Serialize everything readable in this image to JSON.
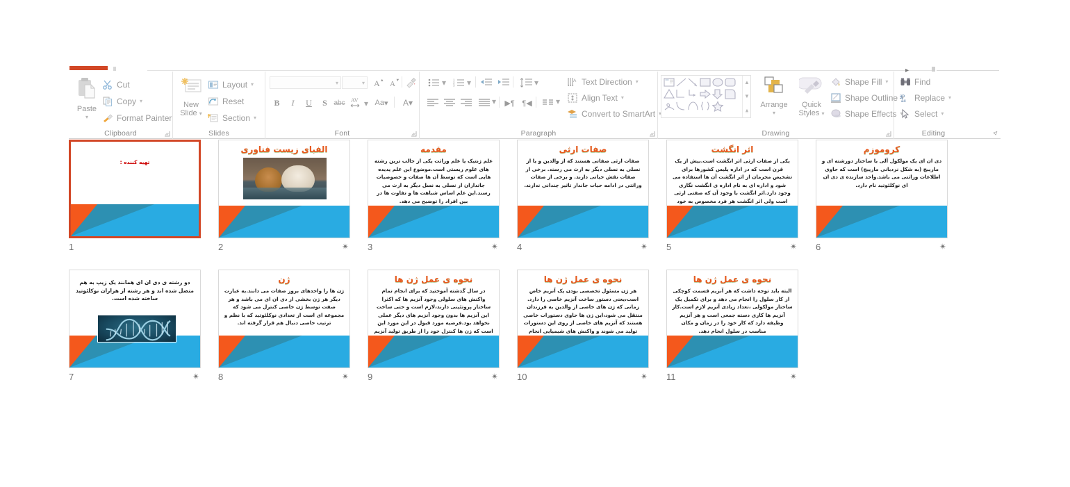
{
  "app": {
    "name": "PowerPoint Slide Sorter",
    "accent_orange": "#d24726",
    "slide_accent_blue": "#29abe2",
    "slide_accent_orange": "#f4581c",
    "title_color": "#e8591e"
  },
  "ribbon": {
    "groups": [
      {
        "name": "clipboard",
        "label": "Clipboard",
        "big_button": {
          "label_line1": "Paste",
          "caret": "▾",
          "icon": "paste-icon"
        },
        "items": [
          {
            "label": "Cut",
            "icon": "scissors-icon",
            "caret": ""
          },
          {
            "label": "Copy",
            "icon": "copy-icon",
            "caret": "▾"
          },
          {
            "label": "Format Painter",
            "icon": "format-painter-icon",
            "caret": ""
          }
        ],
        "has_launcher": true
      },
      {
        "name": "slides",
        "label": "Slides",
        "big_button": {
          "label_line1": "New",
          "label_line2": "Slide",
          "caret": "▾",
          "icon": "new-slide-icon"
        },
        "items": [
          {
            "label": "Layout",
            "icon": "layout-icon",
            "caret": "▾"
          },
          {
            "label": "Reset",
            "icon": "reset-icon",
            "caret": ""
          },
          {
            "label": "Section",
            "icon": "section-icon",
            "caret": "▾"
          }
        ],
        "has_launcher": false
      },
      {
        "name": "font",
        "label": "Font",
        "font_name_value": "",
        "font_size_value": "",
        "buttons": [
          {
            "name": "increase-font-size",
            "glyph": "A˄"
          },
          {
            "name": "decrease-font-size",
            "glyph": "A˅"
          },
          {
            "name": "clear-formatting",
            "glyph": "✐"
          },
          {
            "name": "bold",
            "glyph": "B"
          },
          {
            "name": "italic",
            "glyph": "I"
          },
          {
            "name": "underline",
            "glyph": "U"
          },
          {
            "name": "text-shadow",
            "glyph": "S"
          },
          {
            "name": "strikethrough",
            "glyph": "abc"
          },
          {
            "name": "character-spacing",
            "glyph": "AV"
          },
          {
            "name": "change-case",
            "glyph": "Aa"
          },
          {
            "name": "font-color",
            "glyph": "A"
          }
        ],
        "has_launcher": true
      },
      {
        "name": "paragraph",
        "label": "Paragraph",
        "items": [
          {
            "label": "Text Direction",
            "icon": "text-direction-icon",
            "caret": "▾"
          },
          {
            "label": "Align Text",
            "icon": "align-text-icon",
            "caret": "▾"
          },
          {
            "label": "Convert to SmartArt",
            "icon": "smartart-icon",
            "caret": "▾"
          }
        ],
        "has_launcher": true
      },
      {
        "name": "drawing",
        "label": "Drawing",
        "big_button_arrange": {
          "label_line1": "Arrange",
          "caret": "▾",
          "icon": "arrange-icon"
        },
        "big_button_quick": {
          "label_line1": "Quick",
          "label_line2": "Styles",
          "caret": "▾",
          "icon": "quick-styles-icon"
        },
        "items": [
          {
            "label": "Shape Fill",
            "icon": "shape-fill-icon",
            "caret": "▾"
          },
          {
            "label": "Shape Outline",
            "icon": "shape-outline-icon",
            "caret": "▾"
          },
          {
            "label": "Shape Effects",
            "icon": "shape-effects-icon",
            "caret": "▾"
          }
        ],
        "has_launcher": true
      },
      {
        "name": "editing",
        "label": "Editing",
        "items": [
          {
            "label": "Find",
            "icon": "binoculars-icon",
            "caret": ""
          },
          {
            "label": "Replace",
            "icon": "replace-icon",
            "caret": "▾"
          },
          {
            "label": "Select",
            "icon": "select-arrow-icon",
            "caret": "▾"
          }
        ],
        "has_launcher": false
      }
    ],
    "collapse_ribbon_glyph": "⌃"
  },
  "slides": [
    {
      "number": "1",
      "selected": true,
      "star": "",
      "title": "",
      "body": "تهیه کننده :",
      "body_red": true,
      "image": "none"
    },
    {
      "number": "2",
      "selected": false,
      "star": "✴",
      "title": "الفبای زیست فناوری",
      "body": "",
      "body_red": false,
      "image": "lions-drinking-water-photo"
    },
    {
      "number": "3",
      "selected": false,
      "star": "✴",
      "title": "مقدمه",
      "body": "علم ژنتیک یا علم وراثت یکی از جالب ترین رشته های علوم زیستی است.موضوع این علم پدیده هایی است که توسط آن ها صفات و خصوصیات جانداران از نسلی به نسل دیگر به ارث می رسند.این علم اساس شباهت ها و تفاوت ها در بین افراد را توضیح می دهد.",
      "body_red": false,
      "image": "none"
    },
    {
      "number": "4",
      "selected": false,
      "star": "✴",
      "title": "صفات ارثی",
      "body": "صفات ارثی صفاتی هستند که از والدین و یا از نسلی به نسلی دیگر به ارث می رسند.\nبرخی از صفات نقش حیاتی دارند.\nو برخی از صفات وراثتی در ادامه حیات جاندار تاثیر چندانی ندارند.",
      "body_red": false,
      "image": "none"
    },
    {
      "number": "5",
      "selected": false,
      "star": "✴",
      "title": "اثر انگشت",
      "body": "یکی از صفات ارثی اثر انگشت است.بیش از یک قرن است که در اداره پلیس کشورها برای تشخیص مجرمان از اثر انگشت آن ها استفاده می شود و اداره ای به نام اداره ی انگشت نگاری وجود دارد.اثر انگشت با وجود آن که صفتی ارثی است ولی اثر انگشت هر فرد مخصوص به خود اوست و نمی توان دو نفر را یافت  که اثر انگشت یکسانی داشته باشند.",
      "body_red": false,
      "image": "none"
    },
    {
      "number": "6",
      "selected": false,
      "star": "✴",
      "title": "کروموزم",
      "body": "دی ان ای یک مولکول آلی با ساختار دورشته ای و مارپیچ (به شکل نردبانی مارپیچ) است که حاوی اطلاعات وراثتی می باشد.واحد سازنده ی دی ان ای نوکلئوتید نام دارد.",
      "body_red": false,
      "image": "none"
    },
    {
      "number": "7",
      "selected": false,
      "star": "✴",
      "title": "",
      "body": "دو رشته ی دی ان ای همانند یک زیپ به هم متصل شده اند و هر رشته از هزاران نوکلئوتید ساخته شده است.",
      "body_red": false,
      "image": "dna-double-helix-photo"
    },
    {
      "number": "8",
      "selected": false,
      "star": "✴",
      "title": "ژن",
      "body": "ژن ها را واحدهای بروز صفات می دانند.به عبارت دیگر هر ژن بخشی از دی ان ای می باشد و هر صفت توسط ژن خاصی کنترل می شود که مجموعه ای است از تعدادی نوکلئوتید که با نظم و ترتیب خاصی دنبال هم قرار گرفته اند.",
      "body_red": false,
      "image": "none"
    },
    {
      "number": "9",
      "selected": false,
      "star": "✴",
      "title": "نحوه ی عمل ژن ها",
      "body": "در سال گذشته آموختید که برای انجام تمام واکنش های سلولی وجود آنزیم ها که اکثرا ساختار پروتئینی دارند،لازم است و حتی ساخت این آنزیم ها بدون وجود آنزیم های دیگر عملی نخواهد بود.فرضیه مورد قبول در این مورد این است که ژن ها کنترل خود را از طریق تولید آنزیم های مشخصی اعمال می کنند.",
      "body_red": false,
      "image": "none"
    },
    {
      "number": "10",
      "selected": false,
      "star": "✴",
      "title": "نحوه ی عمل ژن ها",
      "body": "هر ژن مسئول تخصصی بودن یک آنزیم خاص است،یعنی دستور ساخت  آنزیم خاصی را دارد. زمانی که ژن های خاصی از والدین به فرزندان منتقل می شود،این ژن ها حاوی دستورات خاصی هستند که آنزیم های خاصی از روی این دستورات تولید می شوند و واکنش های شیمیایی انجام شده توسط این آنزیم ها موجب بروز صفاتی می شود که آن ها را در فرد مشاهده می کنیم.",
      "body_red": false,
      "image": "none"
    },
    {
      "number": "11",
      "selected": false,
      "star": "✴",
      "title": "نحوه ی عمل ژن ها",
      "body": "البته باید توجه داشت که هر آنزیم قسمت کوچکی از کار سلول را انجام می دهد و برای تکمیل یک ساختار مولکولی ،تعداد زیادی آنزیم لازم است.کار آنزیم ها کاری دسته جمعی است و هر آنزیم وظیفه دارد که کار خود را در زمان و مکان مناسب در سلول انجام دهد.",
      "body_red": false,
      "image": "none"
    }
  ]
}
